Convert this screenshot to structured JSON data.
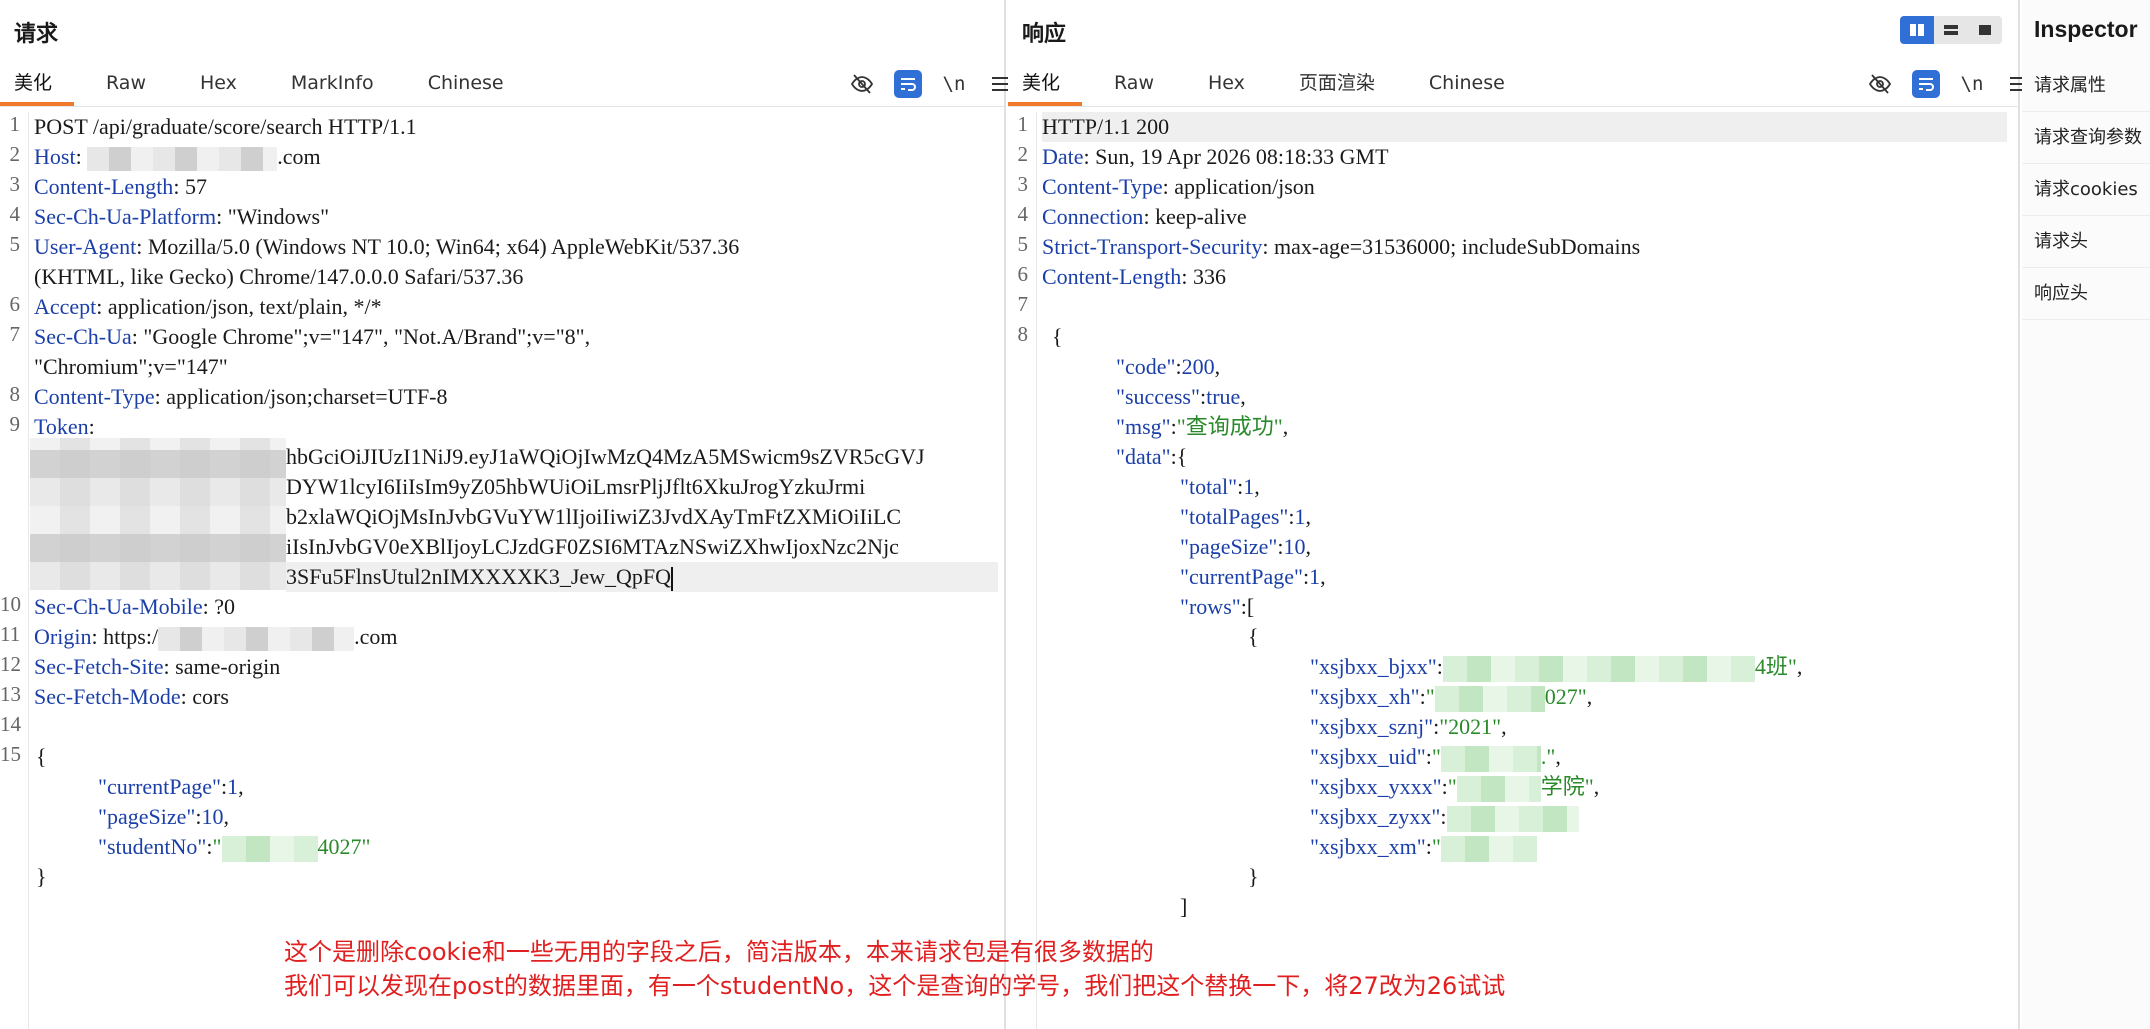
{
  "request": {
    "title": "请求",
    "tabs": [
      "美化",
      "Raw",
      "Hex",
      "MarkInfo",
      "Chinese"
    ],
    "toolbar": {
      "wrap_label": "\\n"
    },
    "lines": {
      "l1": "POST /api/graduate/score/search HTTP/1.1",
      "l2_key": "Host",
      "l2_val": ".com",
      "l3_key": "Content-Length",
      "l3_val": " 57",
      "l4_key": "Sec-Ch-Ua-Platform",
      "l4_val": " \"Windows\"",
      "l5_key": "User-Agent",
      "l5_val": " Mozilla/5.0 (Windows NT 10.0; Win64; x64) AppleWebKit/537.36",
      "l5b": "(KHTML, like Gecko) Chrome/147.0.0.0 Safari/537.36",
      "l6_key": "Accept",
      "l6_val": " application/json, text/plain, */*",
      "l7_key": "Sec-Ch-Ua",
      "l7_val": " \"Google Chrome\";v=\"147\", \"Not.A/Brand\";v=\"8\",",
      "l7b": "\"Chromium\";v=\"147\"",
      "l8_key": "Content-Type",
      "l8_val": " application/json;charset=UTF-8",
      "l9_key": "Token",
      "t1": "hbGciOiJIUzI1NiJ9.eyJ1aWQiOjIwMzQ4MzA5MSwicm9sZVR5cGVJ",
      "t2": "DYW1lcyI6IiIsIm9yZ05hbWUiOiLmsrPljJflt6XkuJrogYzkuJrmi",
      "t3": "b2xlaWQiOjMsInJvbGVuYW1lIjoiIiwiZ3JvdXAyTmFtZXMiOiIiLC",
      "t4": "iIsInJvbGV0eXBlIjoyLCJzdGF0ZSI6MTAzNSwiZXhwIjoxNzc2Njc",
      "t5": "3SFu5FlnsUtul2nIMXXXXK3_Jew_QpFQ",
      "l10_key": "Sec-Ch-Ua-Mobile",
      "l10_val": " ?0",
      "l11_key": "Origin",
      "l11_val": " https:/",
      "l11_tail": ".com",
      "l12_key": "Sec-Fetch-Site",
      "l12_val": " same-origin",
      "l13_key": "Sec-Fetch-Mode",
      "l13_val": " cors",
      "brace_open": "{",
      "k_current": "\"currentPage\"",
      "v_current": "1",
      "k_size": "\"pageSize\"",
      "v_size": "10",
      "k_student": "\"studentNo\"",
      "v_student_tail": "4027\"",
      "brace_close": "}"
    }
  },
  "response": {
    "title": "响应",
    "tabs": [
      "美化",
      "Raw",
      "Hex",
      "页面渲染",
      "Chinese"
    ],
    "toolbar": {
      "wrap_label": "\\n"
    },
    "lines": {
      "l1": "HTTP/1.1 200",
      "l2_key": "Date",
      "l2_val": " Sun, 19 Apr 2026 08:18:33 GMT",
      "l3_key": "Content-Type",
      "l3_val": " application/json",
      "l4_key": "Connection",
      "l4_val": " keep-alive",
      "l5_key": "Strict-Transport-Security",
      "l5_val": " max-age=31536000; includeSubDomains",
      "l6_key": "Content-Length",
      "l6_val": " 336",
      "brace_open": "{",
      "k_code": "\"code\"",
      "v_code": "200",
      "k_success": "\"success\"",
      "v_success": "true",
      "k_msg": "\"msg\"",
      "v_msg": "\"查询成功\"",
      "k_data": "\"data\"",
      "k_total": "\"total\"",
      "v_total": "1",
      "k_totalPages": "\"totalPages\"",
      "v_totalPages": "1",
      "k_pageSize": "\"pageSize\"",
      "v_pageSize": "10",
      "k_currentPage": "\"currentPage\"",
      "v_currentPage": "1",
      "k_rows": "\"rows\"",
      "k_bjxx": "\"xsjbxx_bjxx\"",
      "v_bjxx_tail": "4班\"",
      "k_xh": "\"xsjbxx_xh\"",
      "v_xh_tail": "027\"",
      "k_sznj": "\"xsjbxx_sznj\"",
      "v_sznj": "\"2021\"",
      "k_uid": "\"xsjbxx_uid\"",
      "v_uid_tail": ".\"",
      "k_yxxx": "\"xsjbxx_yxxx\"",
      "v_yxxx_tail": "学院\"",
      "k_zyxx": "\"xsjbxx_zyxx\"",
      "k_xm": "\"xsjbxx_xm\""
    }
  },
  "inspector": {
    "title": "Inspector",
    "items": [
      "请求属性",
      "请求查询参数",
      "请求cookies",
      "请求头",
      "响应头"
    ]
  },
  "annotation": {
    "line1": "这个是删除cookie和一些无用的字段之后，简洁版本，本来请求包是有很多数据的",
    "line2": "我们可以发现在post的数据里面，有一个studentNo，这个是查询的学号，我们把这个替换一下，将27改为26试试"
  },
  "colors": {
    "accent_tab": "#f07a2a",
    "toggle_blue": "#2f6fd6",
    "header_key": "#1b3fa8",
    "json_string": "#2a8a2a",
    "annotation_red": "#e02020"
  }
}
